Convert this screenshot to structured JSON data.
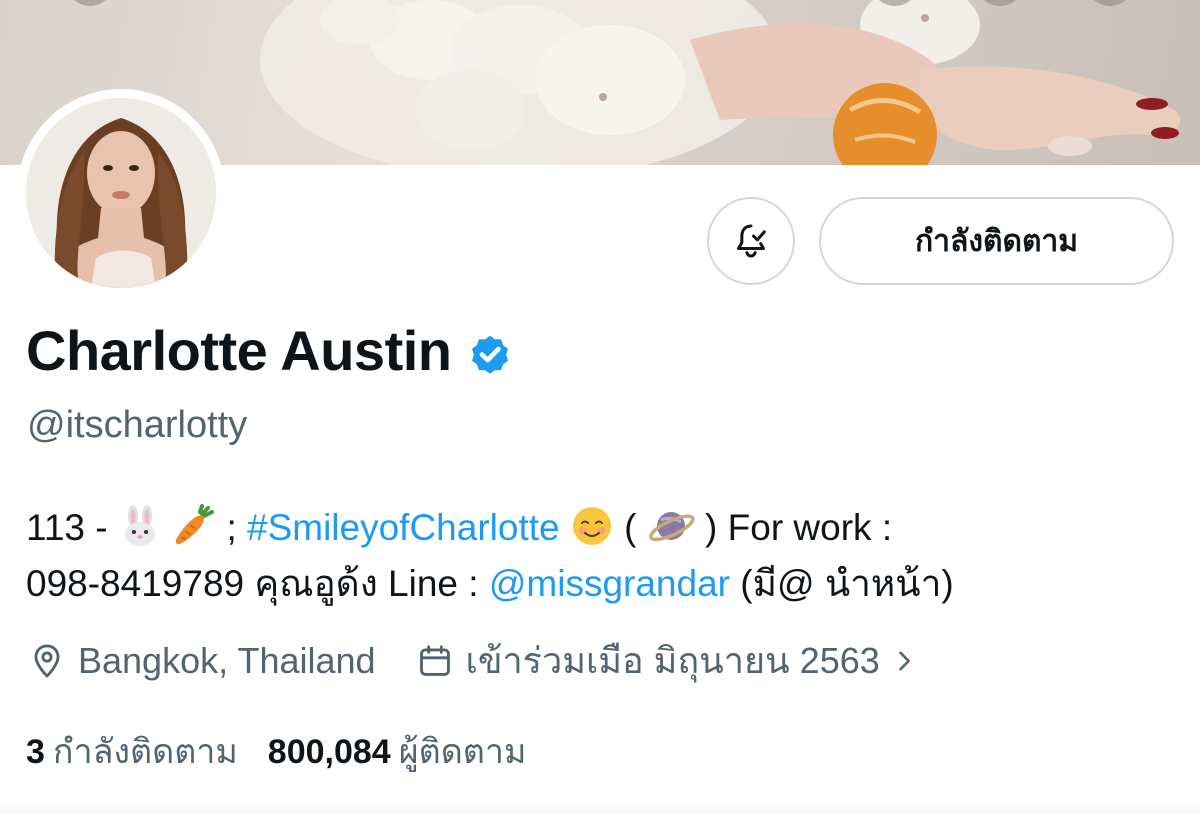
{
  "profile": {
    "display_name": "Charlotte Austin",
    "handle": "@itscharlotty",
    "verified": true
  },
  "actions": {
    "notifications_icon": "bell-check-icon",
    "follow_label": "กำลังติดตาม"
  },
  "bio": {
    "prefix": "113 - ",
    "after_emoji": "; ",
    "hashtag": "#SmileyofCharlotte",
    "paren_open": " (",
    "paren_close": ") For work :",
    "line2_prefix": "098-8419789 คุณอูด้ง Line : ",
    "mention": "@missgrandar",
    "line2_suffix": " (มี@ นำหน้า)",
    "emojis": [
      "rabbit-face",
      "carrot",
      "smiling-face",
      "ringed-planet"
    ]
  },
  "meta": {
    "location": "Bangkok, Thailand",
    "joined": "เข้าร่วมเมือ มิถุนายน 2563",
    "location_icon": "location-pin-icon",
    "joined_icon": "calendar-icon",
    "joined_chevron_icon": "chevron-right-icon"
  },
  "stats": {
    "following_count": "3",
    "following_label": "กำลังติดตาม",
    "followers_count": "800,084",
    "followers_label": "ผู้ติดตาม"
  },
  "colors": {
    "accent": "#1d9bf0",
    "text": "#0f1419",
    "secondary": "#536471",
    "border": "#cfd9de"
  }
}
